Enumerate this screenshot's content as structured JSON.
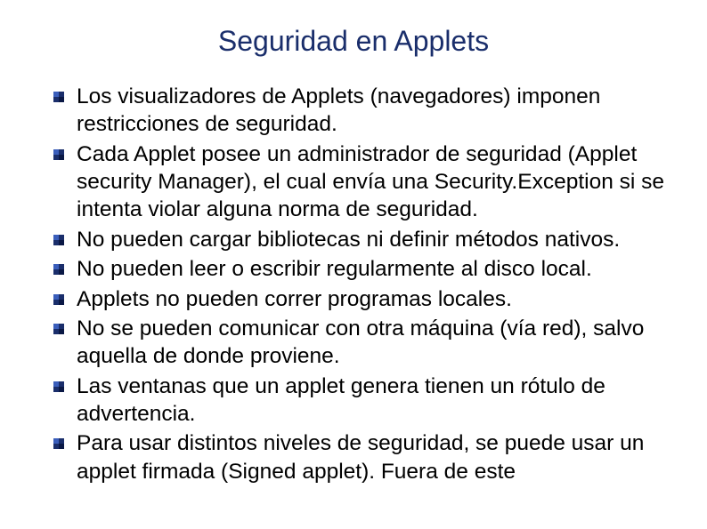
{
  "slide": {
    "title": "Seguridad en Applets",
    "bullets": [
      "Los visualizadores de Applets (navegadores) imponen restricciones de seguridad.",
      "Cada Applet posee un administrador de seguridad (Applet security Manager), el cual envía una Security.Exception si se intenta violar alguna norma de seguridad.",
      "No pueden cargar bibliotecas ni definir métodos nativos.",
      "No pueden leer o escribir regularmente al disco local.",
      "Applets no pueden correr programas locales.",
      "No se pueden comunicar con otra máquina (vía red), salvo aquella de donde proviene.",
      "Las ventanas que un applet genera tienen un rótulo de advertencia.",
      "Para usar distintos niveles de seguridad, se puede usar un applet firmada (Signed applet). Fuera de este"
    ]
  }
}
